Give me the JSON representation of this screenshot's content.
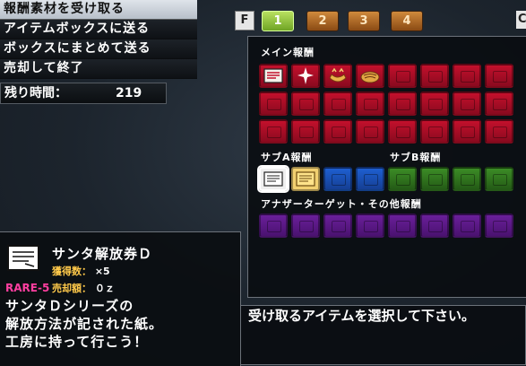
{
  "menu": {
    "items": [
      "報酬素材を受け取る",
      "アイテムボックスに送る",
      "ボックスにまとめて送る",
      "売却して終了"
    ]
  },
  "time": {
    "label": "残り時間：",
    "value": "219"
  },
  "tabs": {
    "f": "F",
    "c": "C",
    "pages": [
      "1",
      "2",
      "3",
      "4"
    ],
    "active": "1"
  },
  "reward": {
    "main_label": "メイン報酬",
    "sub_a_label": "サブA報酬",
    "sub_b_label": "サブB報酬",
    "another_label": "アナザーターゲット・その他報酬"
  },
  "item": {
    "name": "サンタ解放券Ｄ",
    "count_label": "獲得数：",
    "count_value": "×5",
    "price_label": "売却額：",
    "price_value": "０ｚ",
    "rarity": "RARE-5",
    "desc": [
      "サンタＤシリーズの",
      "解放方法が記された紙。",
      "工房に持って行こう！"
    ]
  },
  "message": "受け取るアイテムを選択して下さい。",
  "colors": {
    "slot_red": "#c3102c",
    "slot_blue": "#1e5fd0",
    "slot_green": "#3c8c26",
    "slot_purple": "#6a1f9a",
    "tab_active": "#8fc83a",
    "tab_inactive": "#c07a30",
    "rare": "#ff3fa0",
    "label_yellow": "#ffc94a"
  },
  "icons": {
    "main_row1": [
      "ticket-red-icon",
      "sparkle-icon",
      "ingredient-icon",
      "bread-icon"
    ],
    "sub_a": [
      "ticket-white-icon",
      "ticket-yellow-icon"
    ],
    "item": "ticket-white-icon"
  }
}
